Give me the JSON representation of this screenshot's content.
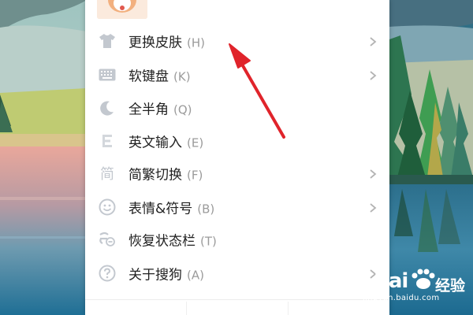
{
  "menu": {
    "items": [
      {
        "label": "更换皮肤",
        "shortcut": "(H)",
        "icon": "tshirt-icon",
        "has_submenu": true
      },
      {
        "label": "软键盘",
        "shortcut": "(K)",
        "icon": "keyboard-icon",
        "has_submenu": true
      },
      {
        "label": "全半角",
        "shortcut": "(Q)",
        "icon": "moon-icon",
        "has_submenu": false
      },
      {
        "label": "英文输入",
        "shortcut": "(E)",
        "icon": "letter-e-icon",
        "has_submenu": false
      },
      {
        "label": "简繁切换",
        "shortcut": "(F)",
        "icon": "jian-character-icon",
        "icon_glyph": "简",
        "has_submenu": true
      },
      {
        "label": "表情&符号",
        "shortcut": "(B)",
        "icon": "smiley-icon",
        "has_submenu": true
      },
      {
        "label": "恢复状态栏",
        "shortcut": "(T)",
        "icon": "restore-statusbar-icon",
        "has_submenu": false
      },
      {
        "label": "关于搜狗",
        "shortcut": "(A)",
        "icon": "question-circle-icon",
        "has_submenu": true
      }
    ]
  },
  "watermark": {
    "brand": "Bai",
    "tag": "经验",
    "url": "jingyan.baidu.com"
  },
  "colors": {
    "menu_bg": "#ffffff",
    "icon_gray": "#c9cdd3",
    "label_text": "#222222",
    "shortcut_text": "#9b9b9b",
    "arrow_red": "#e0242b"
  }
}
